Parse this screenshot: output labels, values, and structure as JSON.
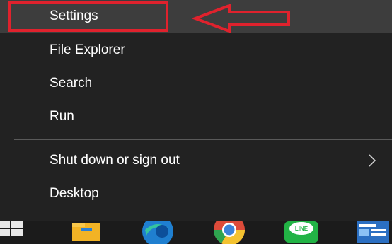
{
  "menu": {
    "items": [
      {
        "label": "Settings"
      },
      {
        "label": "File Explorer"
      },
      {
        "label": "Search"
      },
      {
        "label": "Run"
      },
      {
        "label": "Shut down or sign out"
      },
      {
        "label": "Desktop"
      }
    ]
  },
  "annotation": {
    "color": "#e0222d"
  },
  "taskbar": {
    "icons": [
      "windows-start-icon",
      "file-explorer-icon",
      "edge-icon",
      "chrome-icon",
      "line-icon",
      "news-icon"
    ]
  }
}
